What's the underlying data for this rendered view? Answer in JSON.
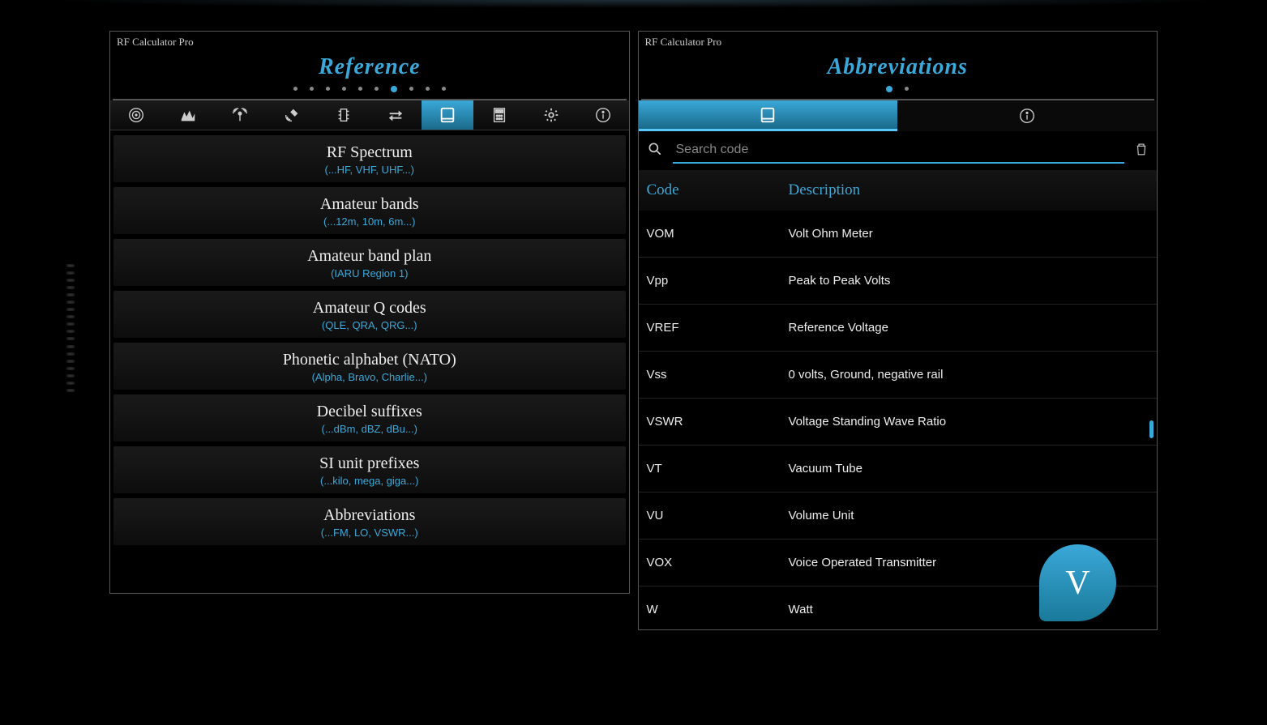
{
  "left": {
    "app_title": "RF Calculator Pro",
    "screen_title": "Reference",
    "dots": {
      "total": 10,
      "active": 6
    },
    "toolbar_active": 6,
    "items": [
      {
        "title": "RF Spectrum",
        "sub": "(...HF, VHF, UHF...)"
      },
      {
        "title": "Amateur bands",
        "sub": "(...12m, 10m, 6m...)"
      },
      {
        "title": "Amateur band plan",
        "sub": "(IARU Region 1)"
      },
      {
        "title": "Amateur Q codes",
        "sub": "(QLE, QRA, QRG...)"
      },
      {
        "title": "Phonetic alphabet (NATO)",
        "sub": "(Alpha, Bravo, Charlie...)"
      },
      {
        "title": "Decibel suffixes",
        "sub": "(...dBm, dBZ, dBu...)"
      },
      {
        "title": "SI unit prefixes",
        "sub": "(...kilo, mega, giga...)"
      },
      {
        "title": "Abbreviations",
        "sub": "(...FM, LO, VSWR...)"
      }
    ]
  },
  "right": {
    "app_title": "RF Calculator Pro",
    "screen_title": "Abbreviations",
    "dots": {
      "total": 2,
      "active": 0
    },
    "search_placeholder": "Search code",
    "header_code": "Code",
    "header_desc": "Description",
    "rows": [
      {
        "code": "VOM",
        "desc": "Volt Ohm Meter"
      },
      {
        "code": "Vpp",
        "desc": "Peak to Peak Volts"
      },
      {
        "code": "VREF",
        "desc": "Reference Voltage"
      },
      {
        "code": "Vss",
        "desc": "0 volts, Ground, negative rail"
      },
      {
        "code": "VSWR",
        "desc": "Voltage Standing Wave Ratio"
      },
      {
        "code": "VT",
        "desc": "Vacuum Tube"
      },
      {
        "code": "VU",
        "desc": "Volume Unit"
      },
      {
        "code": "VOX",
        "desc": "Voice Operated Transmitter"
      },
      {
        "code": "W",
        "desc": "Watt"
      }
    ],
    "index_letter": "V"
  }
}
